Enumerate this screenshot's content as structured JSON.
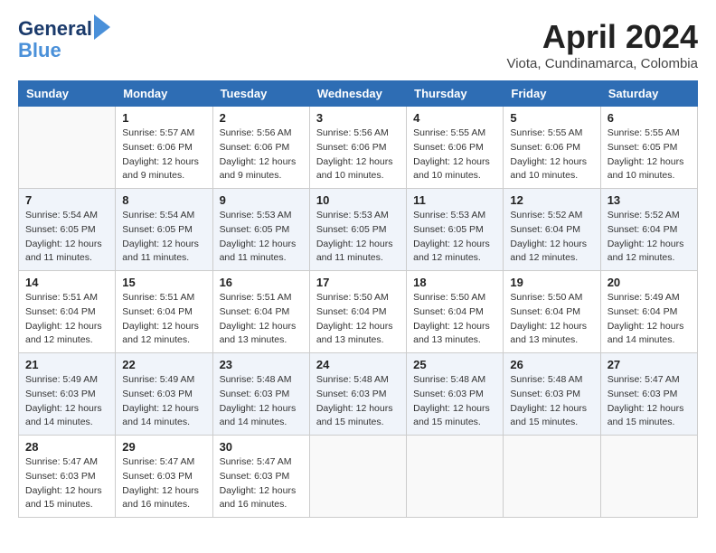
{
  "header": {
    "logo_line1": "General",
    "logo_line2": "Blue",
    "month_title": "April 2024",
    "location": "Viota, Cundinamarca, Colombia"
  },
  "weekdays": [
    "Sunday",
    "Monday",
    "Tuesday",
    "Wednesday",
    "Thursday",
    "Friday",
    "Saturday"
  ],
  "weeks": [
    [
      {
        "day": "",
        "sunrise": "",
        "sunset": "",
        "daylight": ""
      },
      {
        "day": "1",
        "sunrise": "Sunrise: 5:57 AM",
        "sunset": "Sunset: 6:06 PM",
        "daylight": "Daylight: 12 hours and 9 minutes."
      },
      {
        "day": "2",
        "sunrise": "Sunrise: 5:56 AM",
        "sunset": "Sunset: 6:06 PM",
        "daylight": "Daylight: 12 hours and 9 minutes."
      },
      {
        "day": "3",
        "sunrise": "Sunrise: 5:56 AM",
        "sunset": "Sunset: 6:06 PM",
        "daylight": "Daylight: 12 hours and 10 minutes."
      },
      {
        "day": "4",
        "sunrise": "Sunrise: 5:55 AM",
        "sunset": "Sunset: 6:06 PM",
        "daylight": "Daylight: 12 hours and 10 minutes."
      },
      {
        "day": "5",
        "sunrise": "Sunrise: 5:55 AM",
        "sunset": "Sunset: 6:06 PM",
        "daylight": "Daylight: 12 hours and 10 minutes."
      },
      {
        "day": "6",
        "sunrise": "Sunrise: 5:55 AM",
        "sunset": "Sunset: 6:05 PM",
        "daylight": "Daylight: 12 hours and 10 minutes."
      }
    ],
    [
      {
        "day": "7",
        "sunrise": "Sunrise: 5:54 AM",
        "sunset": "Sunset: 6:05 PM",
        "daylight": "Daylight: 12 hours and 11 minutes."
      },
      {
        "day": "8",
        "sunrise": "Sunrise: 5:54 AM",
        "sunset": "Sunset: 6:05 PM",
        "daylight": "Daylight: 12 hours and 11 minutes."
      },
      {
        "day": "9",
        "sunrise": "Sunrise: 5:53 AM",
        "sunset": "Sunset: 6:05 PM",
        "daylight": "Daylight: 12 hours and 11 minutes."
      },
      {
        "day": "10",
        "sunrise": "Sunrise: 5:53 AM",
        "sunset": "Sunset: 6:05 PM",
        "daylight": "Daylight: 12 hours and 11 minutes."
      },
      {
        "day": "11",
        "sunrise": "Sunrise: 5:53 AM",
        "sunset": "Sunset: 6:05 PM",
        "daylight": "Daylight: 12 hours and 12 minutes."
      },
      {
        "day": "12",
        "sunrise": "Sunrise: 5:52 AM",
        "sunset": "Sunset: 6:04 PM",
        "daylight": "Daylight: 12 hours and 12 minutes."
      },
      {
        "day": "13",
        "sunrise": "Sunrise: 5:52 AM",
        "sunset": "Sunset: 6:04 PM",
        "daylight": "Daylight: 12 hours and 12 minutes."
      }
    ],
    [
      {
        "day": "14",
        "sunrise": "Sunrise: 5:51 AM",
        "sunset": "Sunset: 6:04 PM",
        "daylight": "Daylight: 12 hours and 12 minutes."
      },
      {
        "day": "15",
        "sunrise": "Sunrise: 5:51 AM",
        "sunset": "Sunset: 6:04 PM",
        "daylight": "Daylight: 12 hours and 12 minutes."
      },
      {
        "day": "16",
        "sunrise": "Sunrise: 5:51 AM",
        "sunset": "Sunset: 6:04 PM",
        "daylight": "Daylight: 12 hours and 13 minutes."
      },
      {
        "day": "17",
        "sunrise": "Sunrise: 5:50 AM",
        "sunset": "Sunset: 6:04 PM",
        "daylight": "Daylight: 12 hours and 13 minutes."
      },
      {
        "day": "18",
        "sunrise": "Sunrise: 5:50 AM",
        "sunset": "Sunset: 6:04 PM",
        "daylight": "Daylight: 12 hours and 13 minutes."
      },
      {
        "day": "19",
        "sunrise": "Sunrise: 5:50 AM",
        "sunset": "Sunset: 6:04 PM",
        "daylight": "Daylight: 12 hours and 13 minutes."
      },
      {
        "day": "20",
        "sunrise": "Sunrise: 5:49 AM",
        "sunset": "Sunset: 6:04 PM",
        "daylight": "Daylight: 12 hours and 14 minutes."
      }
    ],
    [
      {
        "day": "21",
        "sunrise": "Sunrise: 5:49 AM",
        "sunset": "Sunset: 6:03 PM",
        "daylight": "Daylight: 12 hours and 14 minutes."
      },
      {
        "day": "22",
        "sunrise": "Sunrise: 5:49 AM",
        "sunset": "Sunset: 6:03 PM",
        "daylight": "Daylight: 12 hours and 14 minutes."
      },
      {
        "day": "23",
        "sunrise": "Sunrise: 5:48 AM",
        "sunset": "Sunset: 6:03 PM",
        "daylight": "Daylight: 12 hours and 14 minutes."
      },
      {
        "day": "24",
        "sunrise": "Sunrise: 5:48 AM",
        "sunset": "Sunset: 6:03 PM",
        "daylight": "Daylight: 12 hours and 15 minutes."
      },
      {
        "day": "25",
        "sunrise": "Sunrise: 5:48 AM",
        "sunset": "Sunset: 6:03 PM",
        "daylight": "Daylight: 12 hours and 15 minutes."
      },
      {
        "day": "26",
        "sunrise": "Sunrise: 5:48 AM",
        "sunset": "Sunset: 6:03 PM",
        "daylight": "Daylight: 12 hours and 15 minutes."
      },
      {
        "day": "27",
        "sunrise": "Sunrise: 5:47 AM",
        "sunset": "Sunset: 6:03 PM",
        "daylight": "Daylight: 12 hours and 15 minutes."
      }
    ],
    [
      {
        "day": "28",
        "sunrise": "Sunrise: 5:47 AM",
        "sunset": "Sunset: 6:03 PM",
        "daylight": "Daylight: 12 hours and 15 minutes."
      },
      {
        "day": "29",
        "sunrise": "Sunrise: 5:47 AM",
        "sunset": "Sunset: 6:03 PM",
        "daylight": "Daylight: 12 hours and 16 minutes."
      },
      {
        "day": "30",
        "sunrise": "Sunrise: 5:47 AM",
        "sunset": "Sunset: 6:03 PM",
        "daylight": "Daylight: 12 hours and 16 minutes."
      },
      {
        "day": "",
        "sunrise": "",
        "sunset": "",
        "daylight": ""
      },
      {
        "day": "",
        "sunrise": "",
        "sunset": "",
        "daylight": ""
      },
      {
        "day": "",
        "sunrise": "",
        "sunset": "",
        "daylight": ""
      },
      {
        "day": "",
        "sunrise": "",
        "sunset": "",
        "daylight": ""
      }
    ]
  ]
}
